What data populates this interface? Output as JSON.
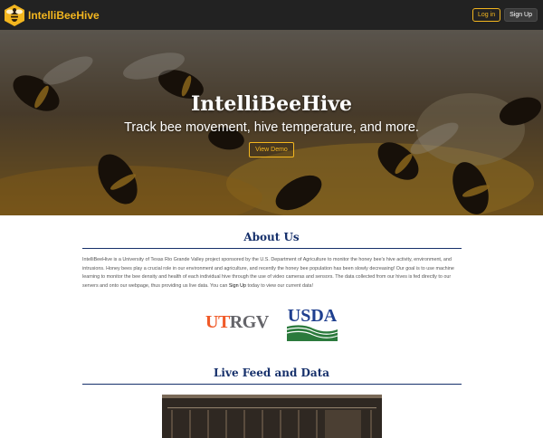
{
  "navbar": {
    "brand_name": "IntelliBeeHive",
    "logo_icon": "bee-hexagon-icon",
    "login_label": "Log in",
    "signup_label": "Sign Up",
    "accent_color": "#f3b61f"
  },
  "hero": {
    "title": "IntelliBeeHive",
    "subtitle": "Track bee movement, hive temperature, and more.",
    "cta_label": "View Demo"
  },
  "about": {
    "heading": "About Us",
    "paragraph_part1": "IntelliBeeHive is a University of Texas Rio Grande Valley project sponsored by the U.S. Department of Agriculture to monitor the honey bee's hive activity, environment, and intrusions. Honey bees play a crucial role in our environment and agriculture, and recently the honey bee population has been slowly decreasing! Our goal is to use machine learning to monitor the bee density and health of each individual hive through the use of video cameras and sensors. The data collected from our hives is fed directly to our servers and onto our webpage, thus providing us live data. You can ",
    "signup_link": "Sign Up",
    "paragraph_part2": " today to view our current data!",
    "heading_color": "#16306b",
    "partners": {
      "utrgv": {
        "ut": "UT",
        "rgv": "RGV"
      },
      "usda": "USDA"
    }
  },
  "live_feed": {
    "heading": "Live Feed and Data"
  }
}
